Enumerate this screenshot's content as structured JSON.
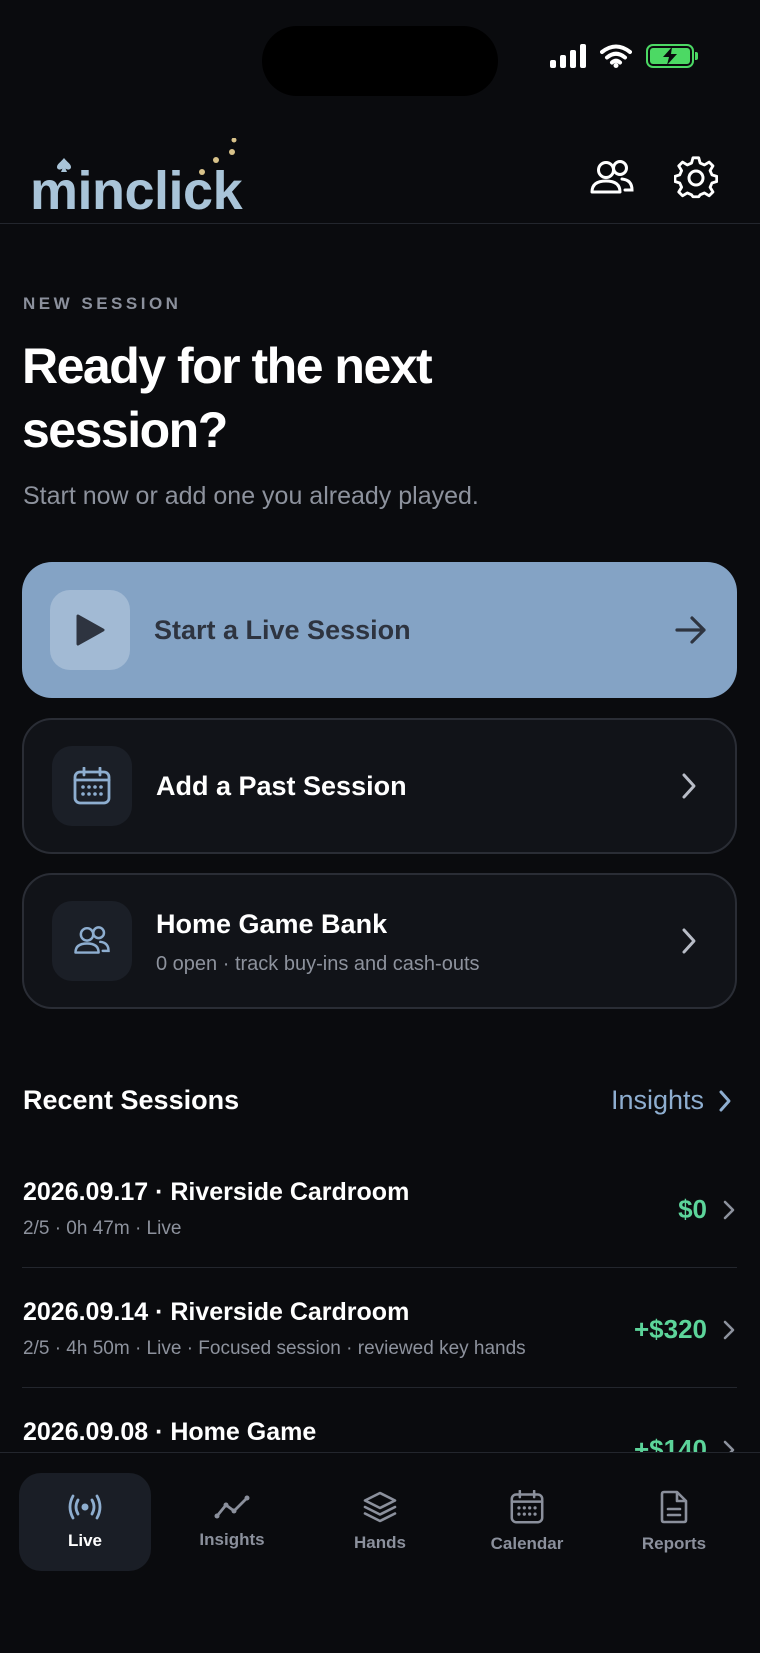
{
  "app": {
    "logo_text": "minclick"
  },
  "header": {
    "people_icon": "people-icon",
    "settings_icon": "gear-icon"
  },
  "hero": {
    "eyebrow": "NEW SESSION",
    "title": "Ready for the next session?",
    "subtitle": "Start now or add one you already played."
  },
  "actions": {
    "live": {
      "label": "Start a Live Session",
      "icon": "play-icon"
    },
    "past": {
      "label": "Add a Past Session",
      "icon": "calendar-icon"
    },
    "home": {
      "label": "Home Game Bank",
      "sub": "0 open · track buy-ins and cash-outs",
      "icon": "people-icon"
    }
  },
  "recent": {
    "title": "Recent Sessions",
    "insights_label": "Insights",
    "sessions": [
      {
        "title": "2026.09.17 · Riverside Cardroom",
        "sub": "2/5 · 0h 47m · Live",
        "amount": "$0"
      },
      {
        "title": "2026.09.14 · Riverside Cardroom",
        "sub": "2/5 · 4h 50m · Live · Focused session · reviewed key hands",
        "amount": "+$320"
      },
      {
        "title": "2026.09.08 · Home Game",
        "sub": "",
        "amount": "+$140"
      }
    ]
  },
  "tabs": [
    {
      "label": "Live",
      "icon": "broadcast-icon",
      "active": true
    },
    {
      "label": "Insights",
      "icon": "trend-icon",
      "active": false
    },
    {
      "label": "Hands",
      "icon": "layers-icon",
      "active": false
    },
    {
      "label": "Calendar",
      "icon": "calendar-icon",
      "active": false
    },
    {
      "label": "Reports",
      "icon": "document-icon",
      "active": false
    }
  ],
  "colors": {
    "background": "#0a0b0e",
    "accent": "#84a3c5",
    "positive": "#5cd49a",
    "logo": "#a9c4d8"
  }
}
